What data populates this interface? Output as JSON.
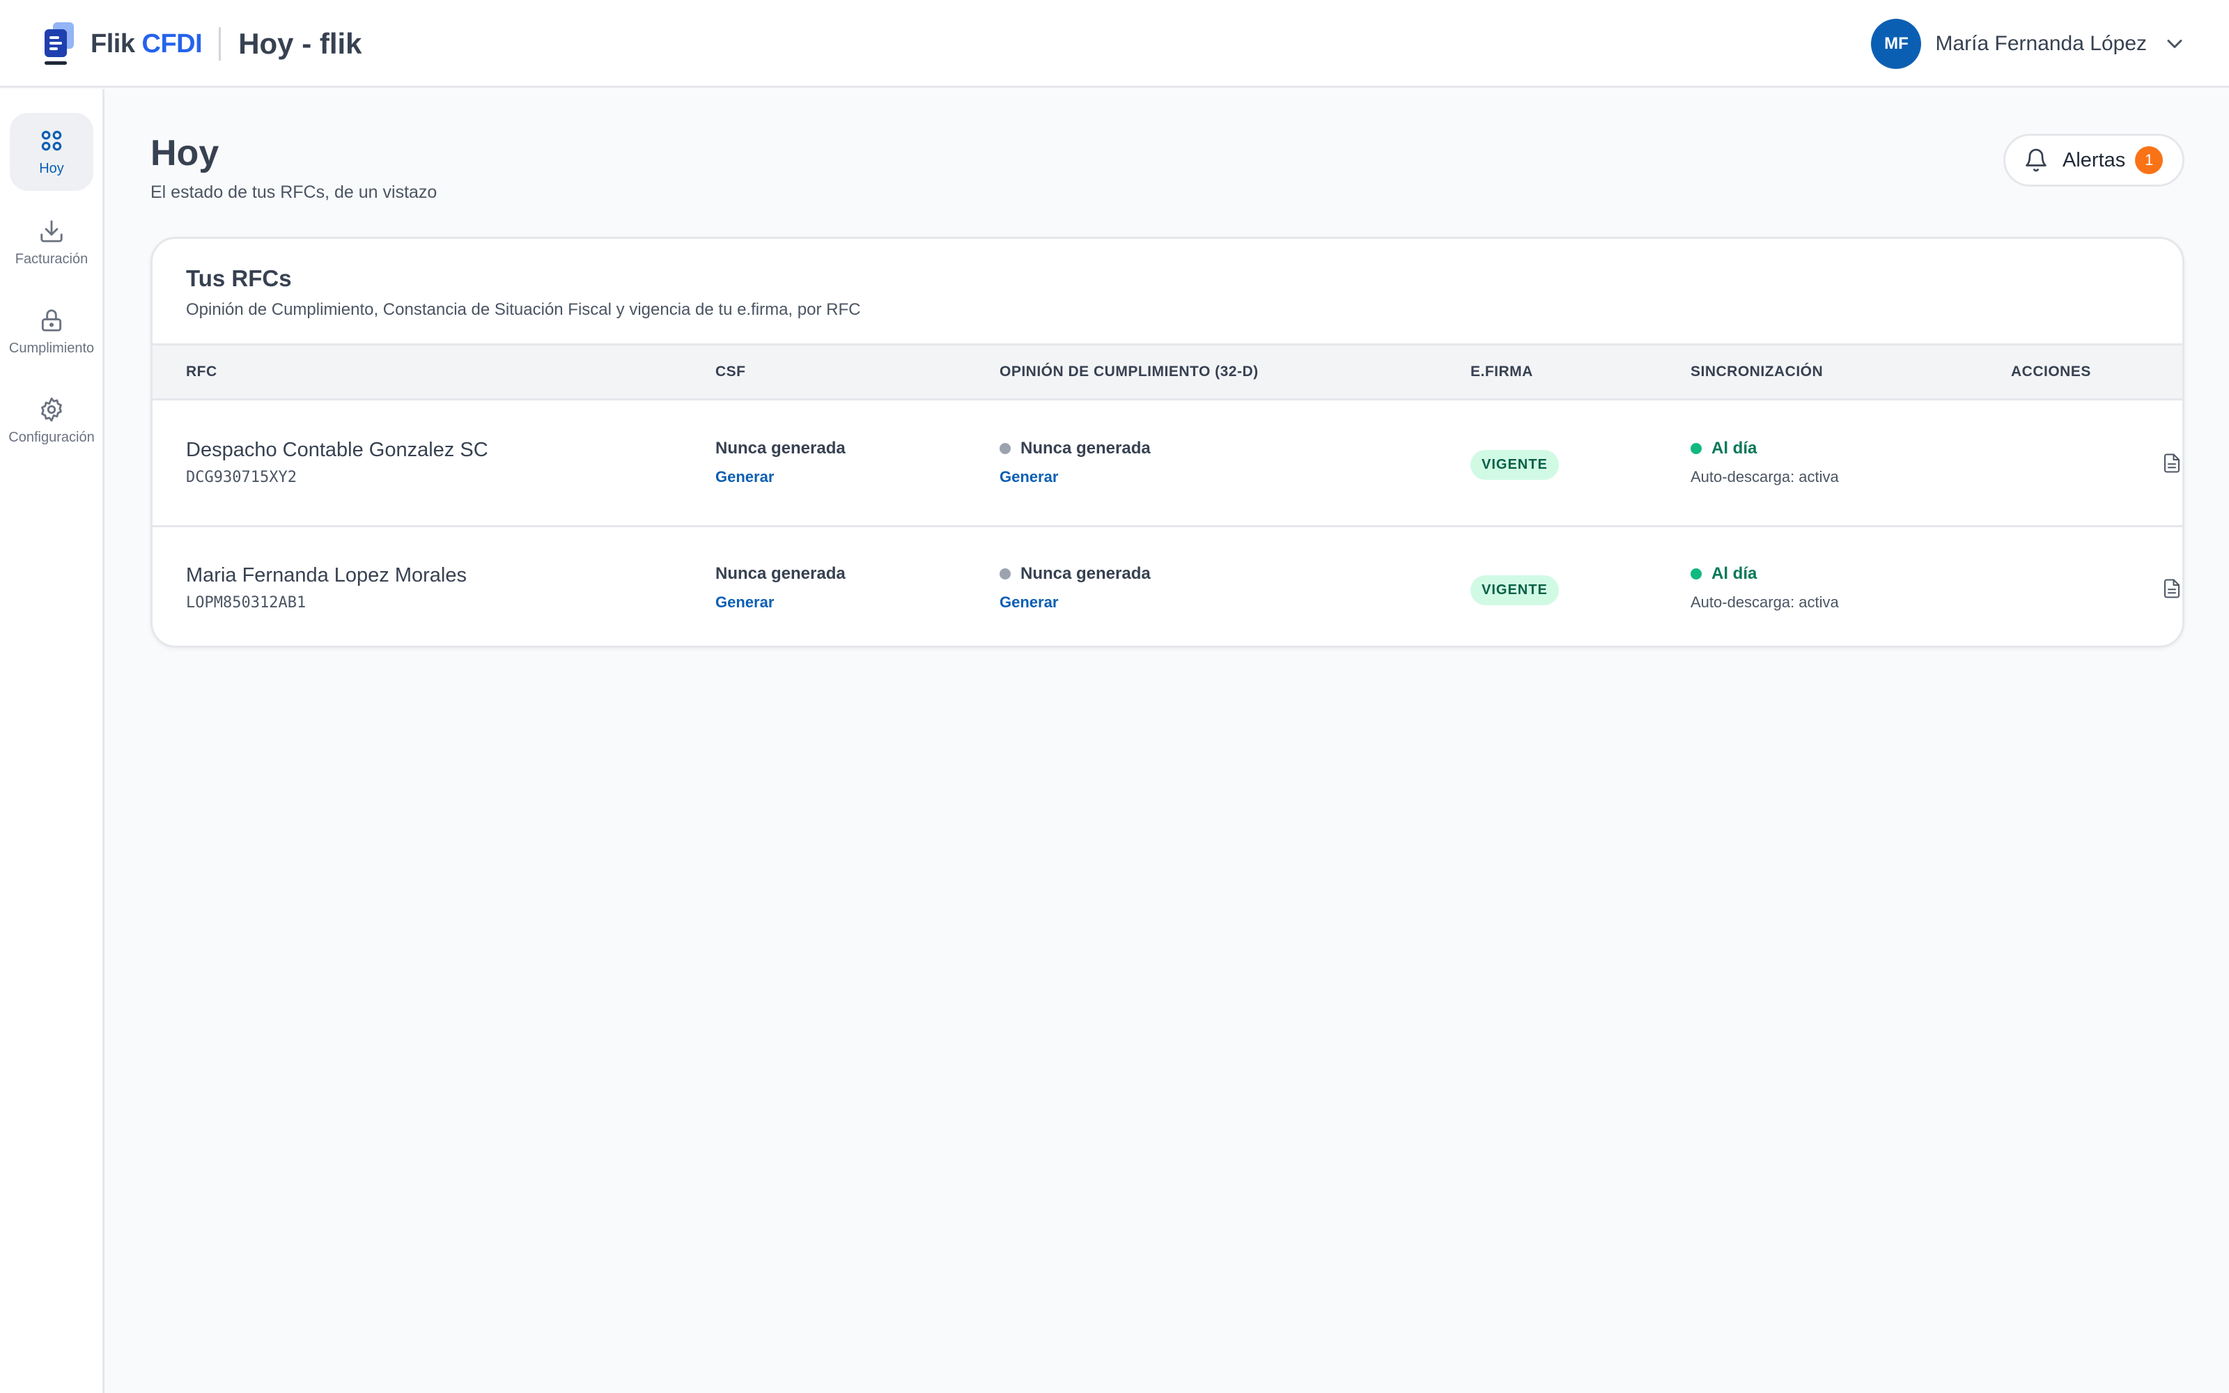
{
  "header": {
    "brand_name": "Flik",
    "brand_accent": "CFDI",
    "page_title": "Hoy - flik",
    "user_initials": "MF",
    "user_name": "María Fernanda López"
  },
  "sidebar": {
    "items": [
      {
        "label": "Hoy",
        "icon": "grid-icon",
        "active": true
      },
      {
        "label": "Facturación",
        "icon": "download-icon",
        "active": false
      },
      {
        "label": "Cumplimiento",
        "icon": "lock-icon",
        "active": false
      },
      {
        "label": "Configuración",
        "icon": "gear-icon",
        "active": false
      }
    ]
  },
  "main": {
    "title": "Hoy",
    "subtitle": "El estado de tus RFCs, de un vistazo",
    "alerts_label": "Alertas",
    "alerts_count": "1"
  },
  "card": {
    "title": "Tus RFCs",
    "subtitle": "Opinión de Cumplimiento, Constancia de Situación Fiscal y vigencia de tu e.firma, por RFC",
    "columns": [
      "RFC",
      "CSF",
      "OPINIÓN DE CUMPLIMIENTO (32-D)",
      "E.FIRMA",
      "SINCRONIZACIÓN",
      "ACCIONES"
    ],
    "rows": [
      {
        "name": "Despacho Contable Gonzalez SC",
        "rfc": "DCG930715XY2",
        "csf_status": "Nunca generada",
        "csf_action": "Generar",
        "opinion_status": "Nunca generada",
        "opinion_action": "Generar",
        "efirma": "VIGENTE",
        "sync_status": "Al día",
        "sync_detail": "Auto-descarga: activa"
      },
      {
        "name": "Maria Fernanda Lopez Morales",
        "rfc": "LOPM850312AB1",
        "csf_status": "Nunca generada",
        "csf_action": "Generar",
        "opinion_status": "Nunca generada",
        "opinion_action": "Generar",
        "efirma": "VIGENTE",
        "sync_status": "Al día",
        "sync_detail": "Auto-descarga: activa"
      }
    ]
  },
  "colors": {
    "brand_blue": "#2563eb",
    "primary": "#0b5fb3",
    "alert_orange": "#f97316",
    "success_green": "#10b981",
    "badge_bg": "#d1fae5"
  }
}
